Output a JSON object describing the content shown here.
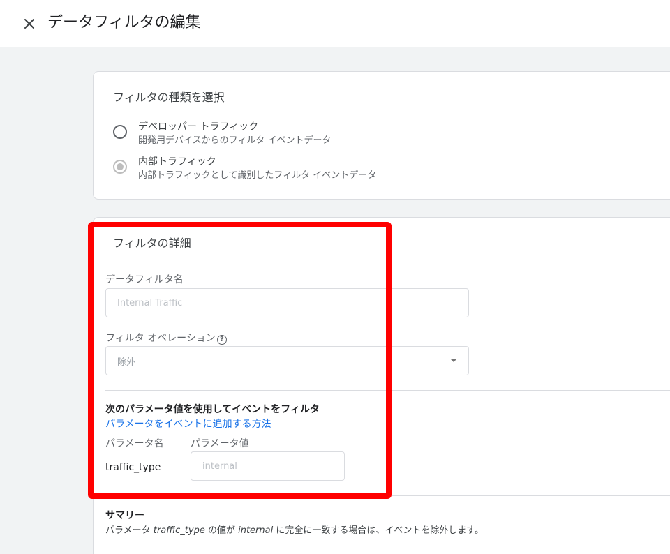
{
  "header": {
    "title": "データフィルタの編集",
    "close_icon": "close-icon"
  },
  "filter_type": {
    "title": "フィルタの種類を選択",
    "options": [
      {
        "label": "デベロッパー トラフィック",
        "description": "開発用デバイスからのフィルタ イベントデータ",
        "selected": false
      },
      {
        "label": "内部トラフィック",
        "description": "内部トラフィックとして識別したフィルタ イベントデータ",
        "selected": true
      }
    ]
  },
  "filter_details": {
    "title": "フィルタの詳細",
    "name_label": "データフィルタ名",
    "name_value": "Internal Traffic",
    "operation_label": "フィルタ オペレーション",
    "operation_help_icon": "help-circle-icon",
    "operation_value": "除外",
    "parameter_heading": "次のパラメータ値を使用してイベントをフィルタ",
    "parameter_help_link": "パラメータをイベントに追加する方法",
    "param_name_header": "パラメータ名",
    "param_value_header": "パラメータ値",
    "param_name": "traffic_type",
    "param_value": "internal"
  },
  "summary": {
    "title": "サマリー",
    "prefix": "パラメータ ",
    "param": "traffic_type",
    "middle": " の値が ",
    "value": "internal",
    "suffix": " に完全に一致する場合は、イベントを除外します。"
  },
  "colors": {
    "highlight": "#ff0000",
    "link": "#1a73e8",
    "background": "#f1f3f4"
  }
}
